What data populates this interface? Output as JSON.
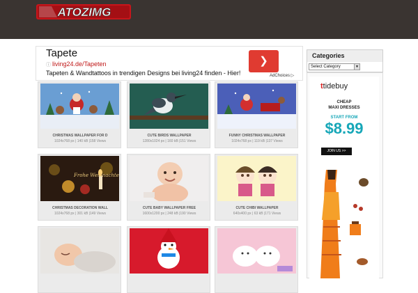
{
  "header": {
    "logo_text": "ATOZIMG",
    "bg_color": "#3a3431"
  },
  "ad": {
    "title": "Tapete",
    "url": "living24.de/Tapeten",
    "description": "Tapeten & Wandtattoos in trendigen Designs bei living24 finden - Hier!",
    "button_icon": "chevron-right-icon",
    "adchoices": "AdChoices"
  },
  "gallery": {
    "cards": [
      {
        "title": "CHRISTMAS WALLPAPER FOR D",
        "meta": "1024x768 px | 140 kB |158 Views"
      },
      {
        "title": "CUTE BIRDS WALLPAPER",
        "meta": "1280x1024 px | 160 kB |151 Views"
      },
      {
        "title": "FUNNY CHRISTMAS WALLPAPER",
        "meta": "1024x768 px | 119 kB |137 Views"
      },
      {
        "title": "CHRISTMAS DECORATION WALL",
        "meta": "1024x768 px | 301 kB |149 Views"
      },
      {
        "title": "CUTE BABY WALLPAPER FREE",
        "meta": "1600x1200 px | 248 kB |190 Views"
      },
      {
        "title": "CUTE CHIBI WALLPAPER",
        "meta": "640x400 px | 63 kB |171 Views"
      },
      {
        "title": "",
        "meta": ""
      },
      {
        "title": "",
        "meta": ""
      },
      {
        "title": "",
        "meta": ""
      }
    ]
  },
  "sidebar": {
    "categories_title": "Categories",
    "select_value": "Select Category"
  },
  "banner": {
    "brand": "tidebuy",
    "line1": "CHEAP",
    "line2": "MAXI DRESSES",
    "line3": "START FROM",
    "price": "$8.99",
    "cta": "JOIN US >>"
  }
}
